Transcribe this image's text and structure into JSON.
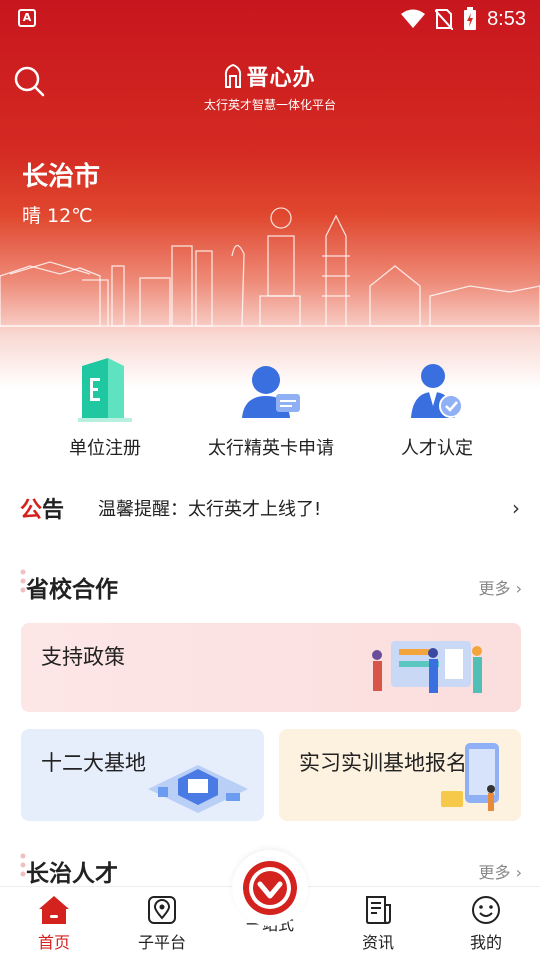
{
  "status_bar": {
    "time": "8:53",
    "app_badge": "A"
  },
  "header": {
    "app_name": "晋心办",
    "subtitle": "太行英才智慧一体化平台"
  },
  "location": {
    "city": "长治市",
    "weather": "晴 12℃"
  },
  "quick_actions": [
    {
      "label": "单位注册",
      "icon": "building-icon"
    },
    {
      "label": "太行精英卡申请",
      "icon": "users-icon"
    },
    {
      "label": "人才认定",
      "icon": "verified-user-icon"
    }
  ],
  "notice": {
    "tag_first": "公",
    "tag_rest": "告",
    "text": "温馨提醒：太行英才上线了!"
  },
  "section1": {
    "title": "省校合作",
    "more": "更多"
  },
  "cards": {
    "policy": "支持政策",
    "bases": "十二大基地",
    "internship": "实习实训基地报名"
  },
  "section2": {
    "title": "长治人才",
    "more": "更多"
  },
  "tabs": [
    {
      "label": "首页",
      "icon": "home-icon"
    },
    {
      "label": "子平台",
      "icon": "location-pin-icon"
    },
    {
      "label": "一站式",
      "icon": "one-stop-icon"
    },
    {
      "label": "资讯",
      "icon": "news-icon"
    },
    {
      "label": "我的",
      "icon": "smiley-icon"
    }
  ],
  "colors": {
    "primary": "#d4231f",
    "hero_top": "#c8161e",
    "teal": "#1fc8a0",
    "blue": "#3a6fe0"
  }
}
